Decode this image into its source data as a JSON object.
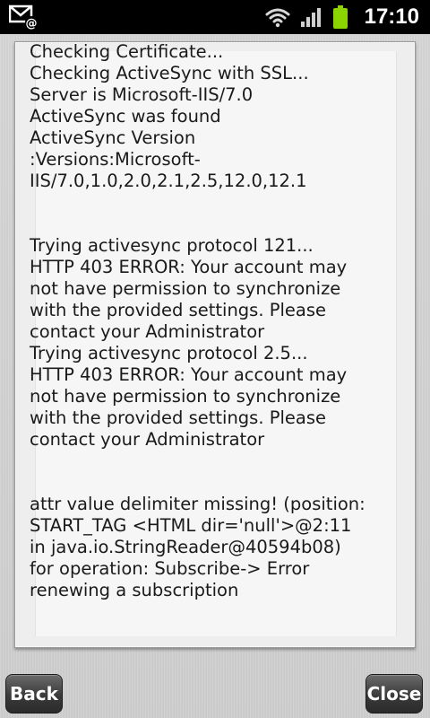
{
  "status_bar": {
    "time": "17:10",
    "icons": [
      "mail-at-icon",
      "wifi-icon",
      "signal-icon",
      "battery-icon"
    ],
    "battery_color": "#8bd400"
  },
  "log": {
    "block1": [
      "Checking Certificate...",
      "Checking ActiveSync with SSL...",
      "Server is Microsoft-IIS/7.0",
      "ActiveSync was found",
      "ActiveSync Version :Versions:Microsoft-IIS/7.0,1.0,2.0,2.1,2.5,12.0,12.1"
    ],
    "block2": [
      "Trying activesync protocol 121...",
      "HTTP 403 ERROR: Your account may not have permission to synchronize with the provided settings. Please contact your Administrator",
      "Trying activesync protocol 2.5...",
      "HTTP 403 ERROR: Your account may not have permission to synchronize with the provided settings. Please contact your Administrator"
    ],
    "block3": [
      "attr value delimiter missing! (position: START_TAG <HTML dir='null'>@2:11 in java.io.StringReader@40594b08)  for operation: Subscribe-> Error renewing a subscription"
    ]
  },
  "buttons": {
    "back_label": "Back",
    "close_label": "Close"
  }
}
